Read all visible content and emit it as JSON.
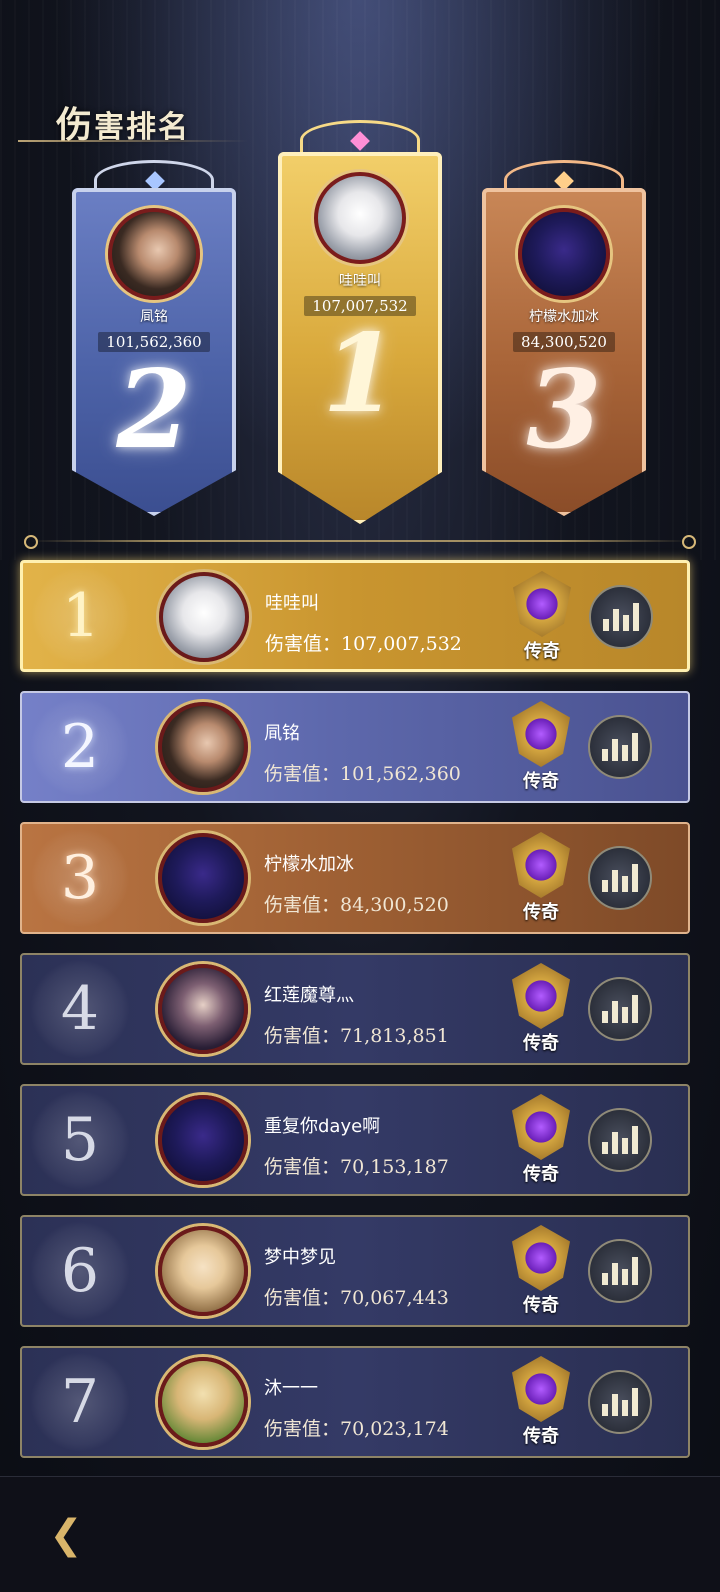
{
  "header": {
    "title_first": "伤",
    "title_rest": "害排名"
  },
  "podium": [
    {
      "rank": "2",
      "name": "凬铭",
      "score": "101,562,360",
      "avatar": "woman-avatar"
    },
    {
      "rank": "1",
      "name": "哇哇叫",
      "score": "107,007,532",
      "avatar": "cat-avatar"
    },
    {
      "rank": "3",
      "name": "柠檬水加冰",
      "score": "84,300,520",
      "avatar": "cloak-avatar"
    }
  ],
  "score_prefix": "伤害值：",
  "badge_label": "传奇",
  "rows": [
    {
      "rank": "1",
      "name": "哇哇叫",
      "score": "伤害值：107,007,532"
    },
    {
      "rank": "2",
      "name": "凬铭",
      "score": "伤害值：101,562,360"
    },
    {
      "rank": "3",
      "name": "柠檬水加冰",
      "score": "伤害值：84,300,520"
    },
    {
      "rank": "4",
      "name": "红莲魔尊灬",
      "score": "伤害值：71,813,851"
    },
    {
      "rank": "5",
      "name": "重复你daye啊",
      "score": "伤害值：70,153,187"
    },
    {
      "rank": "6",
      "name": "梦中梦见",
      "score": "伤害值：70,067,443"
    },
    {
      "rank": "7",
      "name": "沐一一",
      "score": "伤害值：70,023,174"
    }
  ],
  "row_badge_labels": [
    "传奇",
    "传奇",
    "传奇",
    "传奇",
    "传奇",
    "传奇",
    "传奇"
  ],
  "colors": {
    "gold": "#d9a93c",
    "silver_blue": "#5e69ad",
    "bronze": "#9d5f33",
    "row_default": "#343a66"
  },
  "icons": {
    "stats": "bar-chart-icon",
    "back": "back-arrow-icon",
    "badge": "legend-rank-emblem-icon"
  }
}
